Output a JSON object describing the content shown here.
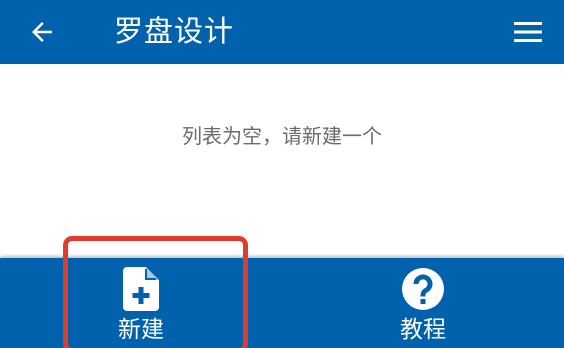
{
  "app_bar": {
    "title": "罗盘设计",
    "back_icon": "arrow-left-icon",
    "menu_icon": "hamburger-menu-icon"
  },
  "content": {
    "empty_message": "列表为空，请新建一个"
  },
  "bottom_nav": {
    "items": [
      {
        "label": "新建",
        "icon": "file-plus-icon"
      },
      {
        "label": "教程",
        "icon": "question-circle-icon"
      }
    ]
  },
  "colors": {
    "primary": "#0062ad",
    "highlight": "#e03c2d",
    "empty_text": "#6b6b6b"
  }
}
